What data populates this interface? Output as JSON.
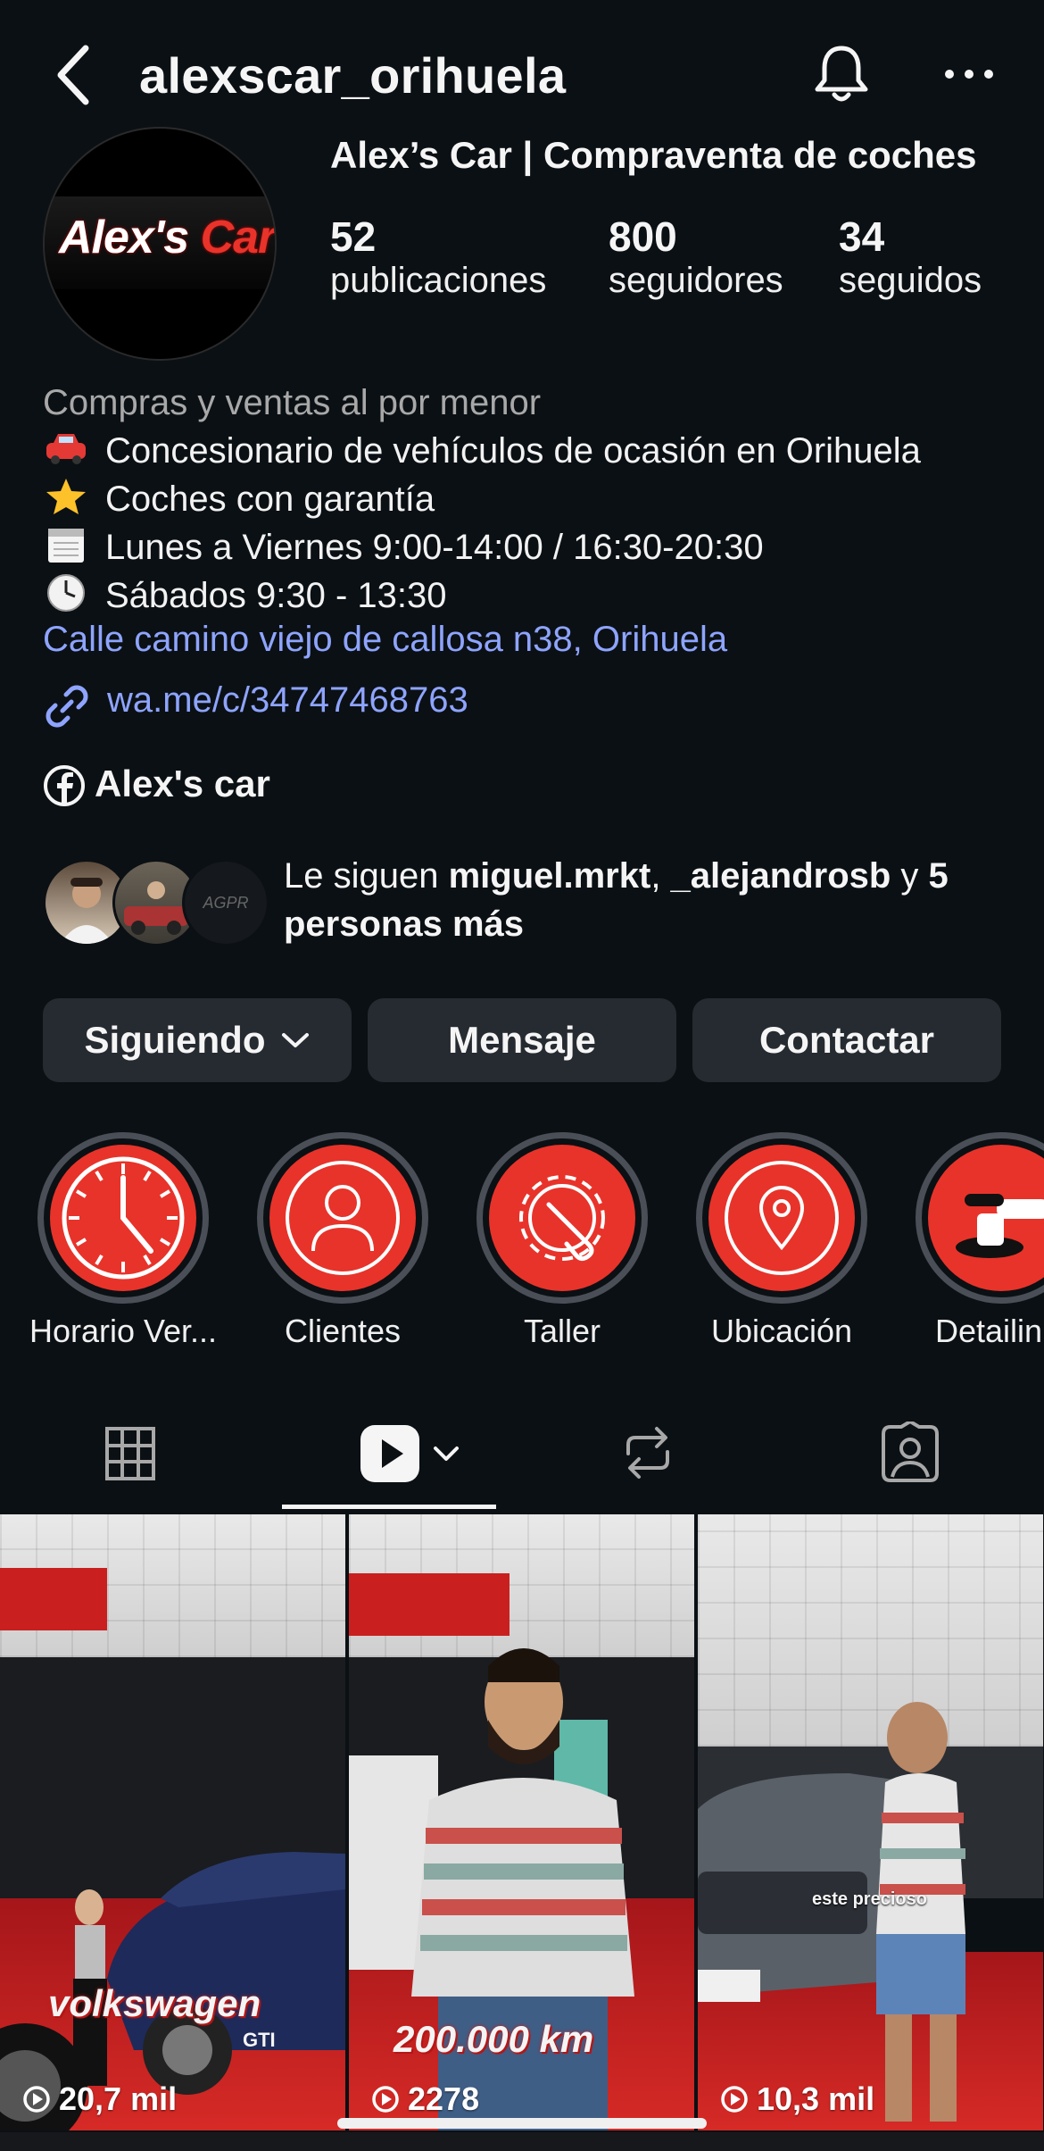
{
  "header": {
    "username": "alexscar_orihuela",
    "back_icon": "chevron-left-icon",
    "bell_icon": "bell-icon",
    "more_icon": "more-horizontal-icon"
  },
  "profile": {
    "avatar_logo": "Alex's Car",
    "display_name": "Alex’s Car | Compraventa de coches",
    "stats": [
      {
        "value": "52",
        "label": "publicaciones"
      },
      {
        "value": "800",
        "label": "seguidores"
      },
      {
        "value": "34",
        "label": "seguidos"
      }
    ],
    "category": "Compras y ventas al por menor",
    "bio_lines": [
      {
        "icon": "car-emoji",
        "text": "Concesionario de vehículos de ocasión en Orihuela"
      },
      {
        "icon": "star-emoji",
        "text": "Coches con garantía"
      },
      {
        "icon": "calendar-emoji",
        "text": "Lunes a Viernes 9:00-14:00 / 16:30-20:30"
      },
      {
        "icon": "clock-emoji",
        "text": "Sábados 9:30 - 13:30"
      }
    ],
    "address": "Calle camino viejo de callosa n38, Orihuela",
    "link": "wa.me/c/34747468763",
    "facebook": "Alex's car"
  },
  "mutual": {
    "prefix": "Le siguen ",
    "user1": "miguel.mrkt",
    "sep": ", ",
    "user2": "_alejandrosb",
    "mid": " y ",
    "more": "5 personas más",
    "third_avatar_text": "AGPR"
  },
  "buttons": {
    "following": "Siguiendo",
    "message": "Mensaje",
    "contact": "Contactar"
  },
  "highlights": [
    {
      "label": "Horario Ver...",
      "icon": "clock-icon"
    },
    {
      "label": "Clientes",
      "icon": "user-icon"
    },
    {
      "label": "Taller",
      "icon": "wrench-gear-icon"
    },
    {
      "label": "Ubicación",
      "icon": "location-pin-icon"
    },
    {
      "label": "Detailin",
      "icon": "polisher-icon"
    }
  ],
  "tabs": [
    "grid-icon",
    "reels-icon",
    "reposts-icon",
    "tagged-icon"
  ],
  "reels": [
    {
      "overlay": "volkswagen",
      "sub": "GTI",
      "views": "20,7 mil"
    },
    {
      "overlay": "200.000 km",
      "sub": "",
      "views": "2278"
    },
    {
      "overlay": "",
      "sub": "este precioso",
      "views": "10,3 mil"
    }
  ],
  "colors": {
    "background": "#0b1014",
    "accent_red": "#e8332a",
    "link_blue": "#8ea4ff",
    "button_bg": "#262b31"
  }
}
